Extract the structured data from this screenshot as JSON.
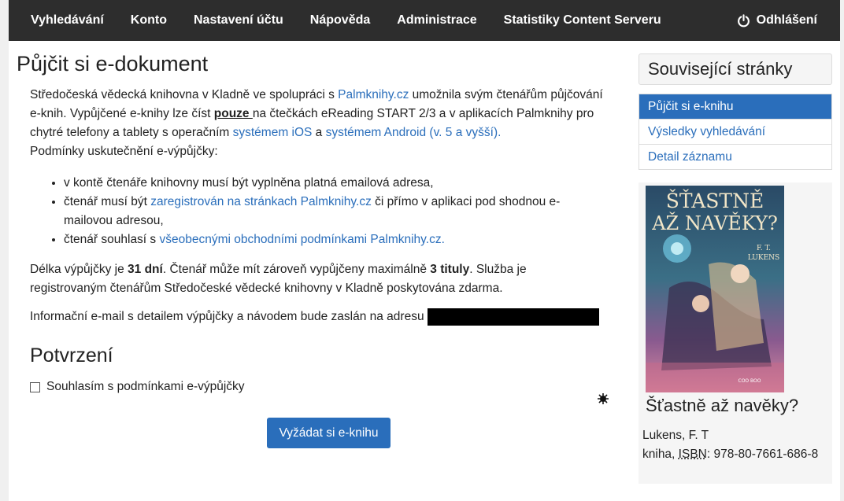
{
  "nav": {
    "items": [
      "Vyhledávání",
      "Konto",
      "Nastavení účtu",
      "Nápověda",
      "Administrace",
      "Statistiky Content Serveru"
    ],
    "logout": "Odhlášení"
  },
  "main": {
    "title": "Půjčit si e-dokument",
    "intro": {
      "t1": "Středočeská vědecká knihovna v Kladně ve spolupráci s ",
      "link_palmknihy": "Palmknihy.cz",
      "t2": " umožnila svým čtenářům půjčování e-knih. Vypůjčené e-knihy lze číst ",
      "pouze": "pouze ",
      "t3": "na čtečkách eReading START 2/3 a v aplikacích Palmknihy pro chytré telefony a tablety s operačním ",
      "link_ios": "systémem iOS",
      "t4": " a ",
      "link_android": "systémem Android (v. 5 a vyšší).",
      "t5": "Podmínky uskutečnění e-výpůjčky:"
    },
    "conditions": {
      "c1": "v kontě čtenáře knihovny musí být vyplněna platná emailová adresa,",
      "c2_a": "čtenář musí být ",
      "c2_link": "zaregistrován na stránkach Palmknihy.cz",
      "c2_b": " či přímo v aplikaci pod shodnou e-mailovou adresou,",
      "c3_a": "čtenář souhlasí s ",
      "c3_link": "všeobecnými obchodními podmínkami Palmknihy.cz."
    },
    "loan": {
      "t1": "Délka výpůjčky je ",
      "days": "31 dní",
      "t2": ". Čtenář může mít zároveň vypůjčeny maximálně ",
      "titles": "3 tituly",
      "t3": ". Služba je registrovaným čtenářům Středočeské vědecké knihovny v Kladně poskytována zdarma."
    },
    "email_text": "Informační e-mail s detailem výpůjčky a návodem bude zaslán na adresu",
    "confirm_heading": "Potvrzení",
    "agree_label": "Souhlasím s podmínkami e-výpůjčky",
    "submit_label": "Vyžádat si e-knihu"
  },
  "sidebar": {
    "heading": "Související stránky",
    "links": [
      "Půjčit si e-knihu",
      "Výsledky vyhledávání",
      "Detail záznamu"
    ]
  },
  "book": {
    "cover_title_1": "ŠŤASTNĚ",
    "cover_title_2": "AŽ NAVĚKY?",
    "cover_author_1": "F. T.",
    "cover_author_2": "LUKENS",
    "cover_publisher": "COO BOO",
    "title": "Šťastně až navěky?",
    "author": "Lukens, F. T",
    "isbn_prefix": "kniha, ",
    "isbn_label": "ISBN",
    "isbn_value": ": 978-80-7661-686-8"
  },
  "colors": {
    "accent": "#2a6ebb",
    "navbar": "#2d2d2d"
  }
}
